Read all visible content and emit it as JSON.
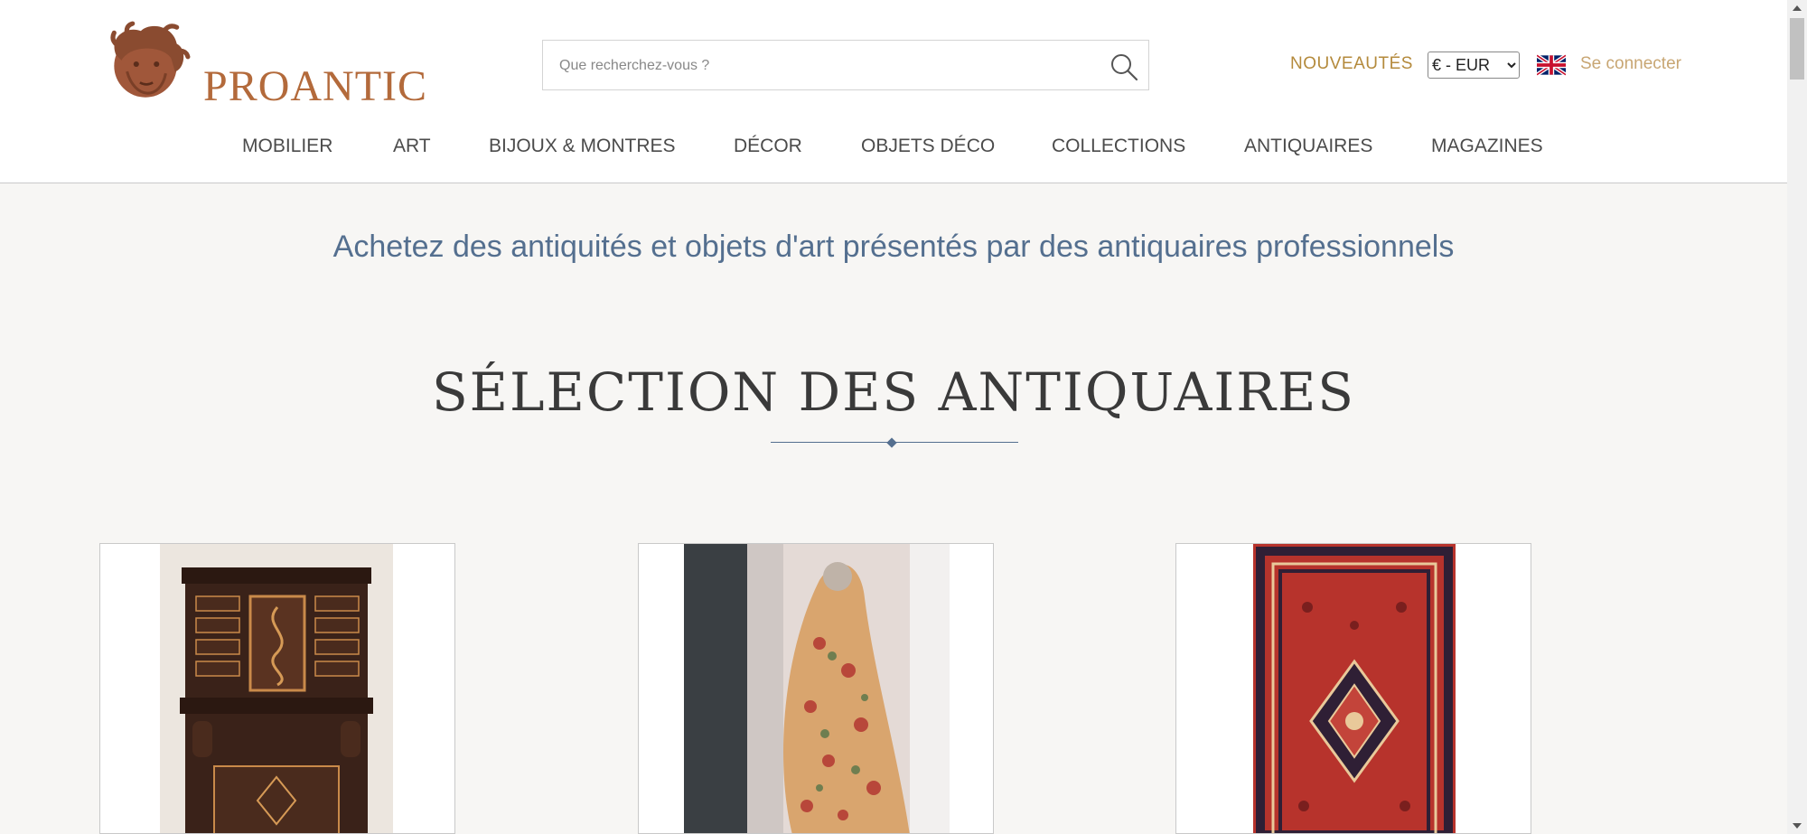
{
  "header": {
    "logo_text": "PROANTIC",
    "search": {
      "placeholder": "Que recherchez-vous ?",
      "value": ""
    },
    "nouveautes_label": "NOUVEAUTÉS",
    "currency": {
      "selected": "€ - EUR",
      "options": [
        "€ - EUR"
      ]
    },
    "language_flag": "uk-flag-icon",
    "login_label": "Se connecter"
  },
  "nav": {
    "items": [
      {
        "label": "MOBILIER"
      },
      {
        "label": "ART"
      },
      {
        "label": "BIJOUX & MONTRES"
      },
      {
        "label": "DÉCOR"
      },
      {
        "label": "OBJETS DÉCO"
      },
      {
        "label": "COLLECTIONS"
      },
      {
        "label": "ANTIQUAIRES"
      },
      {
        "label": "MAGAZINES"
      }
    ]
  },
  "main": {
    "tagline": "Achetez des antiquités et objets d'art présentés par des antiquaires professionnels",
    "section_title": "SÉLECTION DES ANTIQUAIRES"
  },
  "colors": {
    "accent_gold": "#b48a3c",
    "login": "#c8a673",
    "logo": "#b36a3b",
    "tagline_blue": "#546f8f",
    "background": "#f7f6f4"
  },
  "icons": {
    "search": "search-icon",
    "logo_head": "medusa-head-icon",
    "flag": "uk-flag-icon"
  }
}
